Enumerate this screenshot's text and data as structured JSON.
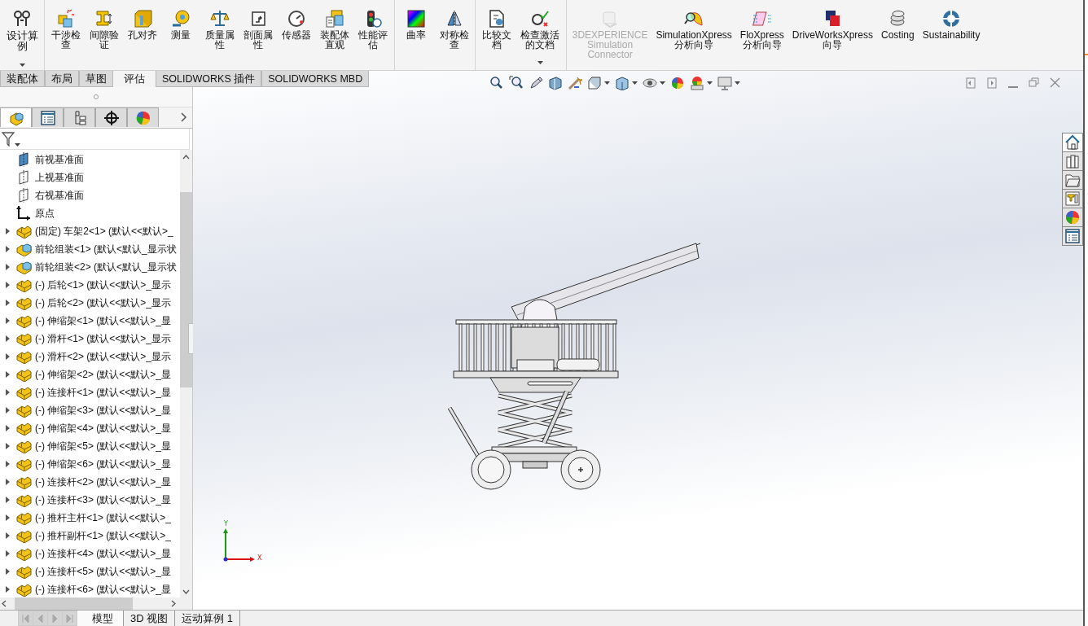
{
  "ribbon": {
    "groups": [
      {
        "buttons": [
          {
            "label": "设计算例",
            "dropdown": true,
            "disabled": false
          }
        ]
      },
      {
        "buttons": [
          {
            "label": "干涉检查",
            "dropdown": false,
            "disabled": false
          },
          {
            "label": "间隙验证",
            "dropdown": false,
            "disabled": false
          },
          {
            "label": "孔对齐",
            "dropdown": false,
            "disabled": false
          },
          {
            "label": "测量",
            "dropdown": false,
            "disabled": false
          },
          {
            "label": "质量属性",
            "dropdown": false,
            "disabled": false
          },
          {
            "label": "剖面属性",
            "dropdown": false,
            "disabled": false
          },
          {
            "label": "传感器",
            "dropdown": false,
            "disabled": false
          },
          {
            "label": "装配体直观",
            "dropdown": false,
            "disabled": false
          },
          {
            "label": "性能评估",
            "dropdown": false,
            "disabled": false
          }
        ]
      },
      {
        "buttons": [
          {
            "label": "曲率",
            "dropdown": false,
            "disabled": false
          },
          {
            "label": "对称检查",
            "dropdown": false,
            "disabled": false
          }
        ]
      },
      {
        "buttons": [
          {
            "label": "比较文档",
            "dropdown": false,
            "disabled": false
          },
          {
            "label": "检查激活的文档",
            "dropdown": true,
            "disabled": false
          }
        ]
      },
      {
        "buttons": [
          {
            "label": "3DEXPERIENCE Simulation Connector",
            "dropdown": false,
            "disabled": true
          },
          {
            "label": "SimulationXpress分析向导",
            "dropdown": false,
            "disabled": false
          },
          {
            "label": "FloXpress分析向导",
            "dropdown": false,
            "disabled": false
          },
          {
            "label": "DriveWorksXpress向导",
            "dropdown": false,
            "disabled": false
          },
          {
            "label": "Costing",
            "dropdown": false,
            "disabled": false
          },
          {
            "label": "Sustainability",
            "dropdown": false,
            "disabled": false
          }
        ]
      }
    ]
  },
  "command_tabs": [
    {
      "label": "装配体",
      "selected": false
    },
    {
      "label": "布局",
      "selected": false
    },
    {
      "label": "草图",
      "selected": false
    },
    {
      "label": "评估",
      "selected": true
    },
    {
      "label": "SOLIDWORKS 插件",
      "selected": false
    },
    {
      "label": "SOLIDWORKS MBD",
      "selected": false
    }
  ],
  "feature_tree": {
    "items": [
      {
        "label": "前视基准面",
        "kind": "plane",
        "visible": true
      },
      {
        "label": "上视基准面",
        "kind": "plane",
        "visible": false
      },
      {
        "label": "右视基准面",
        "kind": "plane",
        "visible": false
      },
      {
        "label": "原点",
        "kind": "origin",
        "visible": true
      },
      {
        "label": "(固定) 车架2<1> (默认<<默认>_",
        "kind": "part",
        "visible": true
      },
      {
        "label": "前轮组装<1> (默认<默认_显示状",
        "kind": "assembly",
        "visible": true
      },
      {
        "label": "前轮组装<2> (默认<默认_显示状",
        "kind": "assembly",
        "visible": true
      },
      {
        "label": "(-) 后轮<1> (默认<<默认>_显示",
        "kind": "part",
        "visible": true
      },
      {
        "label": "(-) 后轮<2> (默认<<默认>_显示",
        "kind": "part",
        "visible": true
      },
      {
        "label": "(-) 伸缩架<1> (默认<<默认>_显",
        "kind": "part",
        "visible": true
      },
      {
        "label": "(-) 滑杆<1> (默认<<默认>_显示",
        "kind": "part",
        "visible": true
      },
      {
        "label": "(-) 滑杆<2> (默认<<默认>_显示",
        "kind": "part",
        "visible": true
      },
      {
        "label": "(-) 伸缩架<2> (默认<<默认>_显",
        "kind": "part",
        "visible": true
      },
      {
        "label": "(-) 连接杆<1> (默认<<默认>_显",
        "kind": "part",
        "visible": true
      },
      {
        "label": "(-) 伸缩架<3> (默认<<默认>_显",
        "kind": "part",
        "visible": true
      },
      {
        "label": "(-) 伸缩架<4> (默认<<默认>_显",
        "kind": "part",
        "visible": true
      },
      {
        "label": "(-) 伸缩架<5> (默认<<默认>_显",
        "kind": "part",
        "visible": true
      },
      {
        "label": "(-) 伸缩架<6> (默认<<默认>_显",
        "kind": "part",
        "visible": true
      },
      {
        "label": "(-) 连接杆<2> (默认<<默认>_显",
        "kind": "part",
        "visible": true
      },
      {
        "label": "(-) 连接杆<3> (默认<<默认>_显",
        "kind": "part",
        "visible": true
      },
      {
        "label": "(-) 推杆主杆<1> (默认<<默认>_",
        "kind": "part",
        "visible": true
      },
      {
        "label": "(-) 推杆副杆<1> (默认<<默认>_",
        "kind": "part",
        "visible": true
      },
      {
        "label": "(-) 连接杆<4> (默认<<默认>_显",
        "kind": "part",
        "visible": true
      },
      {
        "label": "(-) 连接杆<5> (默认<<默认>_显",
        "kind": "part",
        "visible": true
      },
      {
        "label": "(-) 连接杆<6> (默认<<默认>_显",
        "kind": "part",
        "visible": true
      }
    ]
  },
  "triad": {
    "x_label": "X",
    "y_label": "Y"
  },
  "bottom_tabs": [
    {
      "label": "模型",
      "selected": true
    },
    {
      "label": "3D 视图",
      "selected": false
    },
    {
      "label": "运动算例 1",
      "selected": false
    }
  ]
}
